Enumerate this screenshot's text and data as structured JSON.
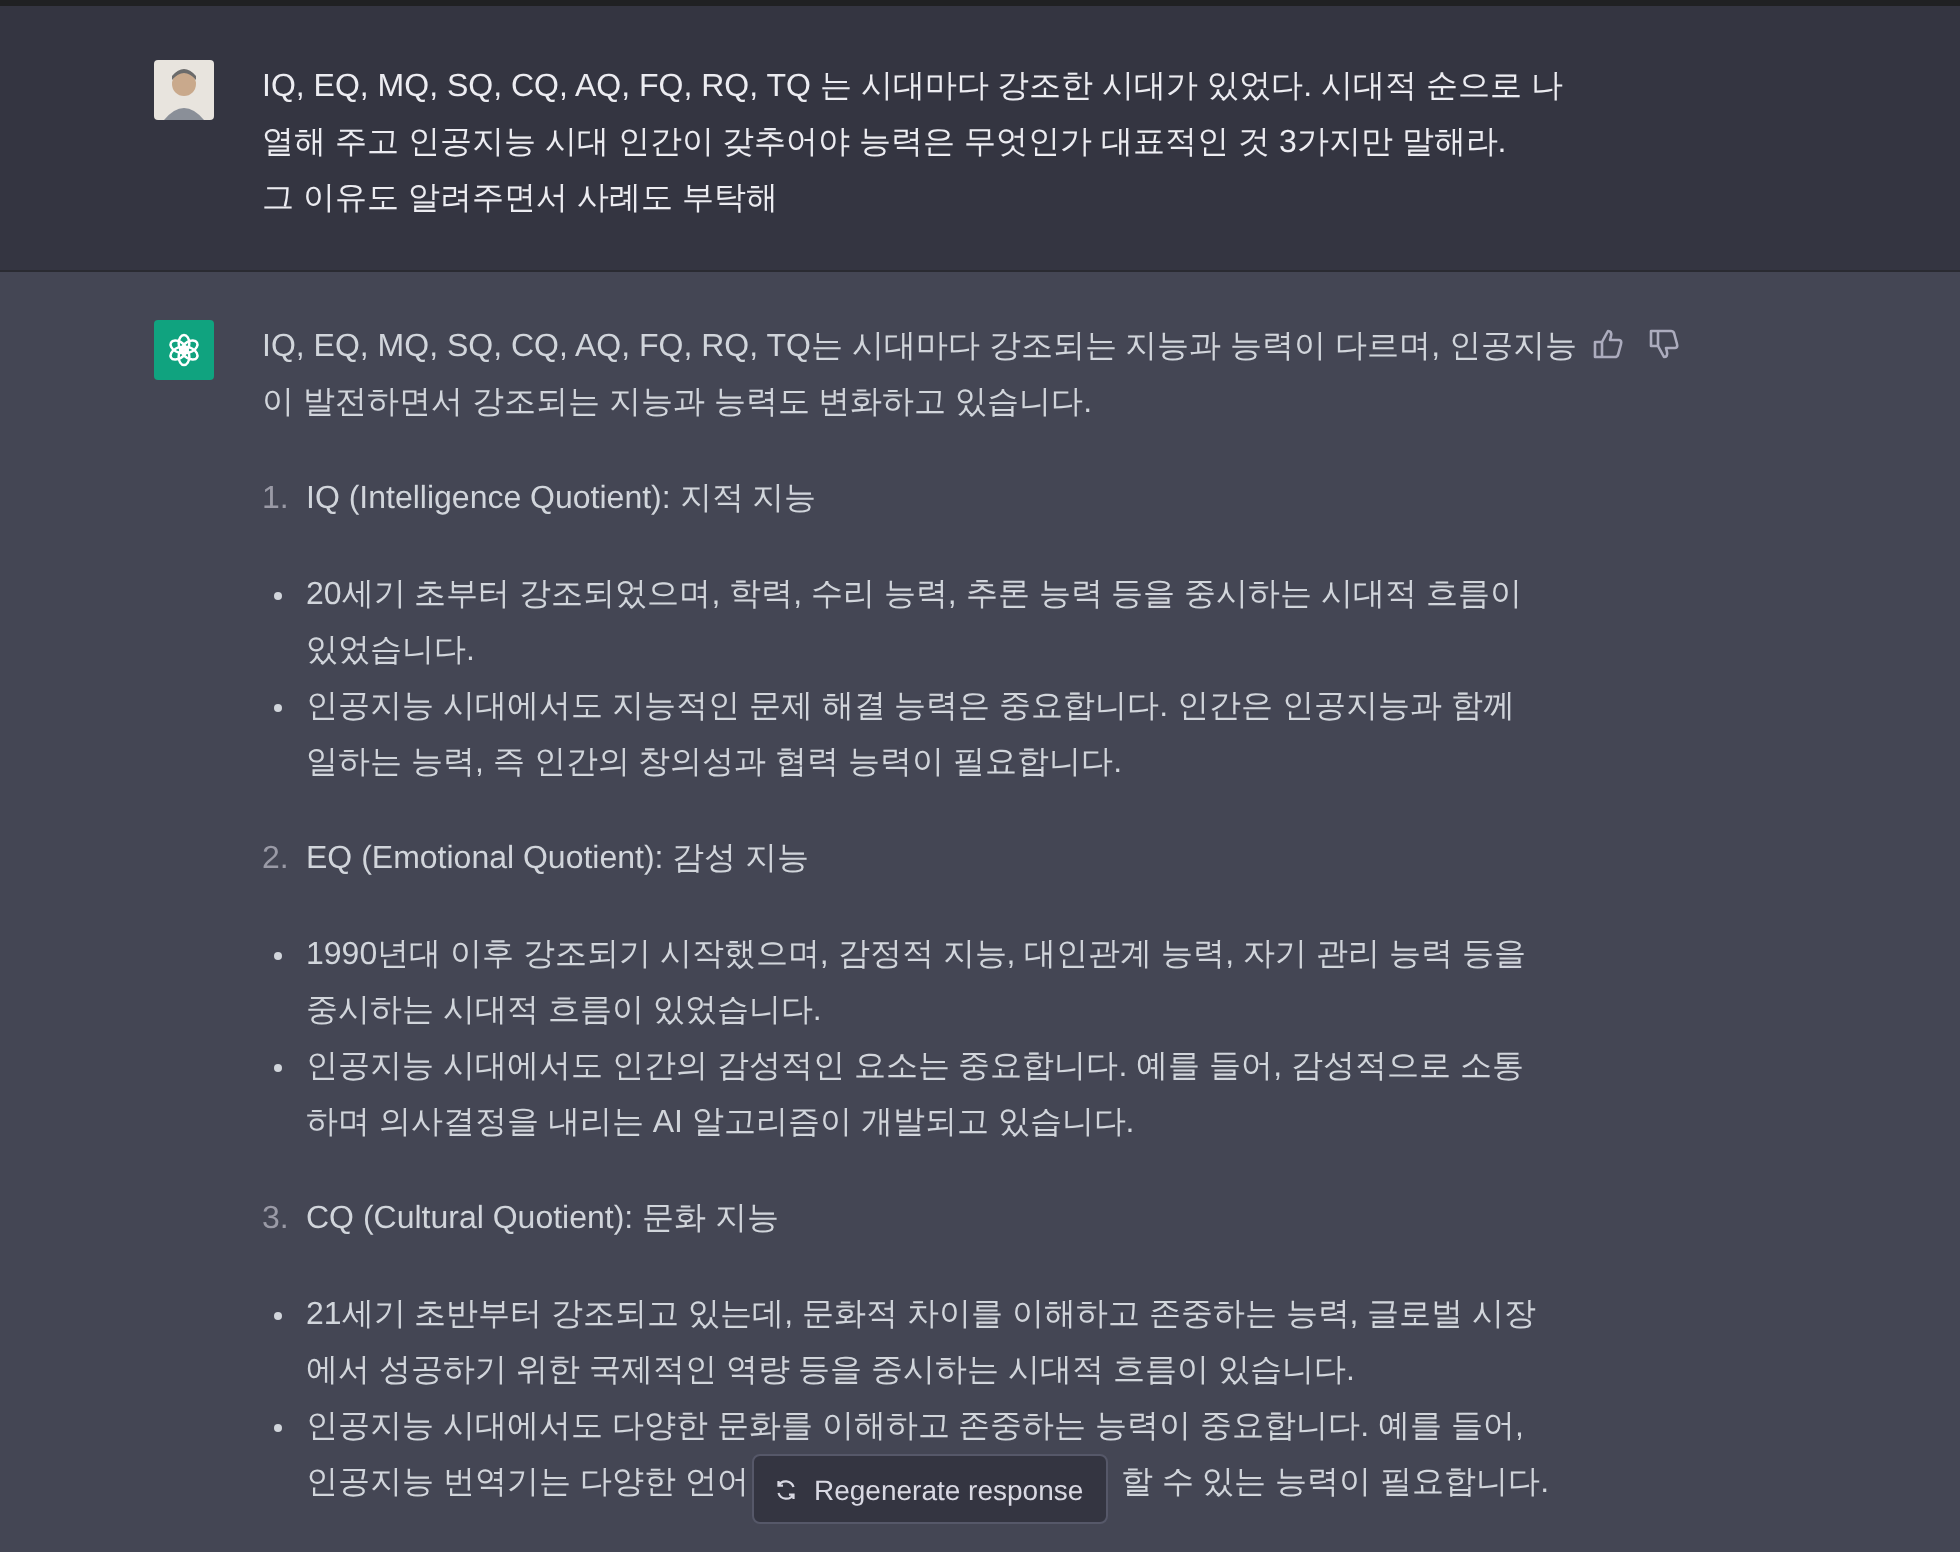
{
  "user_message": {
    "lines": [
      "IQ, EQ, MQ, SQ, CQ, AQ, FQ, RQ, TQ 는 시대마다 강조한 시대가 있었다. 시대적 순으로 나",
      "열해 주고 인공지능 시대 인간이 갖추어야 능력은 무엇인가 대표적인 것 3가지만 말해라.",
      "그 이유도 알려주면서 사례도 부탁해"
    ]
  },
  "assistant_message": {
    "intro_lines": [
      "IQ, EQ, MQ, SQ, CQ, AQ, FQ, RQ, TQ는 시대마다 강조되는 지능과 능력이 다르며, 인공지능",
      "이 발전하면서 강조되는 지능과 능력도 변화하고 있습니다."
    ],
    "sections": [
      {
        "number": "1.",
        "title": "IQ (Intelligence Quotient): 지적 지능",
        "bullets": [
          {
            "lines": [
              "20세기 초부터 강조되었으며, 학력, 수리 능력, 추론 능력 등을 중시하는 시대적 흐름이",
              "있었습니다."
            ]
          },
          {
            "lines": [
              "인공지능 시대에서도 지능적인 문제 해결 능력은 중요합니다. 인간은 인공지능과 함께",
              "일하는 능력, 즉 인간의 창의성과 협력 능력이 필요합니다."
            ]
          }
        ]
      },
      {
        "number": "2.",
        "title": "EQ (Emotional Quotient): 감성 지능",
        "bullets": [
          {
            "lines": [
              "1990년대 이후 강조되기 시작했으며, 감정적 지능, 대인관계 능력, 자기 관리 능력 등을",
              "중시하는 시대적 흐름이 있었습니다."
            ]
          },
          {
            "lines": [
              "인공지능 시대에서도 인간의 감성적인 요소는 중요합니다. 예를 들어, 감성적으로 소통",
              "하며 의사결정을 내리는 AI 알고리즘이 개발되고 있습니다."
            ]
          }
        ]
      },
      {
        "number": "3.",
        "title": "CQ (Cultural Quotient): 문화 지능",
        "bullets": [
          {
            "lines": [
              "21세기 초반부터 강조되고 있는데, 문화적 차이를 이해하고 존중하는 능력, 글로벌 시장",
              "에서 성공하기 위한 국제적인 역량 등을 중시하는 시대적 흐름이 있습니다."
            ]
          },
          {
            "lines": [
              "인공지능 시대에서도 다양한 문화를 이해하고 존중하는 능력이 중요합니다. 예를 들어,",
              "인공지능 번역기는 다양한 언어"
            ],
            "tail": "할 수 있는 능력이 필요합니다."
          }
        ]
      }
    ]
  },
  "regenerate_button": {
    "label": "Regenerate response"
  }
}
